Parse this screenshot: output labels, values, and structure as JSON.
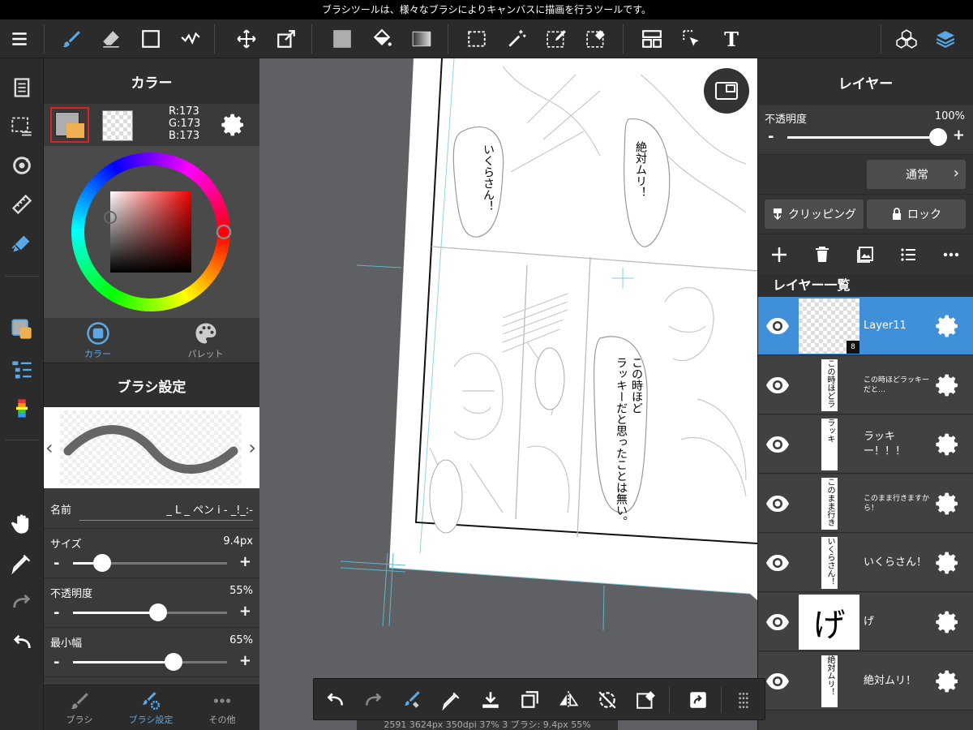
{
  "status": {
    "message": "ブラシツールは、様々なブラシによりキャンバスに描画を行うツールです。"
  },
  "colors": {
    "accent": "#5aa9e6",
    "selected_layer": "#3f90d8",
    "current_color": "#adadad",
    "secondary_color": "#f0b050"
  },
  "toolbar": {
    "icons": [
      "menu-icon",
      "brush-icon",
      "eraser-icon",
      "rectangle-icon",
      "correction-icon",
      "move-icon",
      "transform-icon",
      "fill-color-icon",
      "bucket-icon",
      "gradient-icon",
      "select-rect-icon",
      "magic-wand-icon",
      "select-pen-icon",
      "select-eraser-icon",
      "frame-divide-icon",
      "operation-icon",
      "text-icon",
      "materials-icon",
      "layers-icon"
    ],
    "text_tool_label": "T"
  },
  "color_panel": {
    "title": "カラー",
    "rgb": {
      "r": "R:173",
      "g": "G:173",
      "b": "B:173"
    },
    "tabs": [
      {
        "label": "カラー"
      },
      {
        "label": "パレット"
      }
    ]
  },
  "brush_panel": {
    "title": "ブラシ設定",
    "name_label": "名前",
    "name_value": "_ L _ ペン i - _!_:-",
    "params": [
      {
        "label": "サイズ",
        "value": "9.4px",
        "level": 0.19
      },
      {
        "label": "不透明度",
        "value": "55%",
        "level": 0.55
      },
      {
        "label": "最小幅",
        "value": "65%",
        "level": 0.65
      }
    ],
    "bottom_tabs": [
      {
        "label": "ブラシ"
      },
      {
        "label": "ブラシ設定"
      },
      {
        "label": "その他"
      }
    ]
  },
  "canvas": {
    "bubbles": [
      "いくらさん！",
      "絶対ムリ！",
      "この時ほどラッキーだと思ったことは無い。"
    ],
    "info": "2591 3624px 350dpi 37% 3 ブラシ: 9.4px 55%"
  },
  "layer_panel": {
    "title": "レイヤー",
    "opacity_label": "不透明度",
    "opacity_value": "100%",
    "opacity_level": 1.0,
    "blend_mode": "通常",
    "clipping_label": "クリッピング",
    "lock_label": "ロック",
    "list_title": "レイヤー一覧",
    "layers": [
      {
        "name": "Layer11",
        "selected": true,
        "badge": "8",
        "thumb": "checker"
      },
      {
        "name": "この時ほどラッキーだと…",
        "thumb_text": "この時ほどラッキーだと思ったことは無い。"
      },
      {
        "name": "ラッキー！！！",
        "thumb_text": "ラッキー！！！"
      },
      {
        "name": "このまま行きますから！",
        "thumb_text": "このまま行きますから！"
      },
      {
        "name": "いくらさん！",
        "thumb_text": "いくらさん！"
      },
      {
        "name": "げ",
        "thumb_big": "げ"
      },
      {
        "name": "絶対ムリ！",
        "thumb_text": "絶対ムリ！"
      }
    ]
  }
}
